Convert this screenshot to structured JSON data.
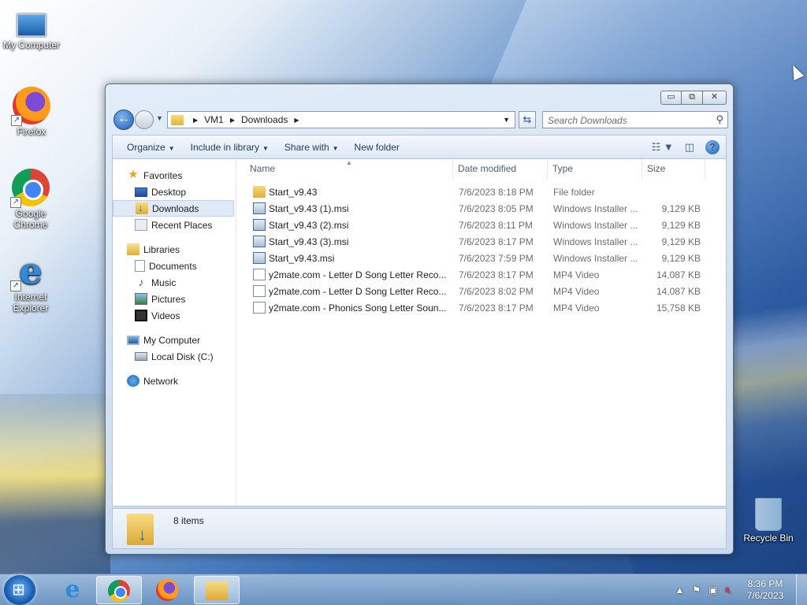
{
  "desktop": {
    "icons": [
      {
        "label": "My Computer",
        "icon": "computer-icon"
      },
      {
        "label": "Firefox",
        "icon": "firefox-icon"
      },
      {
        "label": "Google Chrome",
        "icon": "chrome-icon"
      },
      {
        "label": "Internet Explorer",
        "icon": "ie-icon"
      },
      {
        "label": "Recycle Bin",
        "icon": "recycle-bin-icon"
      }
    ]
  },
  "window": {
    "caption": {
      "minimize": "▭",
      "maximize": "⧉",
      "close": "✕"
    },
    "address": {
      "crumbs": [
        "VM1",
        "Downloads"
      ]
    },
    "search": {
      "placeholder": "Search Downloads"
    },
    "commands": {
      "organize": "Organize",
      "include_in_library": "Include in library",
      "share_with": "Share with",
      "new_folder": "New folder"
    },
    "navpane": {
      "favorites": "Favorites",
      "desktop": "Desktop",
      "downloads": "Downloads",
      "recent_places": "Recent Places",
      "libraries": "Libraries",
      "documents": "Documents",
      "music": "Music",
      "pictures": "Pictures",
      "videos": "Videos",
      "my_computer": "My Computer",
      "local_disk": "Local Disk (C:)",
      "network": "Network"
    },
    "columns": {
      "name": "Name",
      "date": "Date modified",
      "type": "Type",
      "size": "Size"
    },
    "files": [
      {
        "name": "Start_v9.43",
        "date": "7/6/2023 8:18 PM",
        "type": "File folder",
        "size": "",
        "kind": "folder"
      },
      {
        "name": "Start_v9.43 (1).msi",
        "date": "7/6/2023 8:05 PM",
        "type": "Windows Installer ...",
        "size": "9,129 KB",
        "kind": "msi"
      },
      {
        "name": "Start_v9.43 (2).msi",
        "date": "7/6/2023 8:11 PM",
        "type": "Windows Installer ...",
        "size": "9,129 KB",
        "kind": "msi"
      },
      {
        "name": "Start_v9.43 (3).msi",
        "date": "7/6/2023 8:17 PM",
        "type": "Windows Installer ...",
        "size": "9,129 KB",
        "kind": "msi"
      },
      {
        "name": "Start_v9.43.msi",
        "date": "7/6/2023 7:59 PM",
        "type": "Windows Installer ...",
        "size": "9,129 KB",
        "kind": "msi"
      },
      {
        "name": "y2mate.com - Letter D Song  Letter Reco...",
        "date": "7/6/2023 8:17 PM",
        "type": "MP4 Video",
        "size": "14,087 KB",
        "kind": "mp4"
      },
      {
        "name": "y2mate.com - Letter D Song  Letter Reco...",
        "date": "7/6/2023 8:02 PM",
        "type": "MP4 Video",
        "size": "14,087 KB",
        "kind": "mp4"
      },
      {
        "name": "y2mate.com - Phonics Song  Letter Soun...",
        "date": "7/6/2023 8:17 PM",
        "type": "MP4 Video",
        "size": "15,758 KB",
        "kind": "mp4"
      }
    ],
    "details": {
      "item_count": "8 items"
    }
  },
  "taskbar": {
    "clock_time": "8:36 PM",
    "clock_date": "7/6/2023"
  }
}
